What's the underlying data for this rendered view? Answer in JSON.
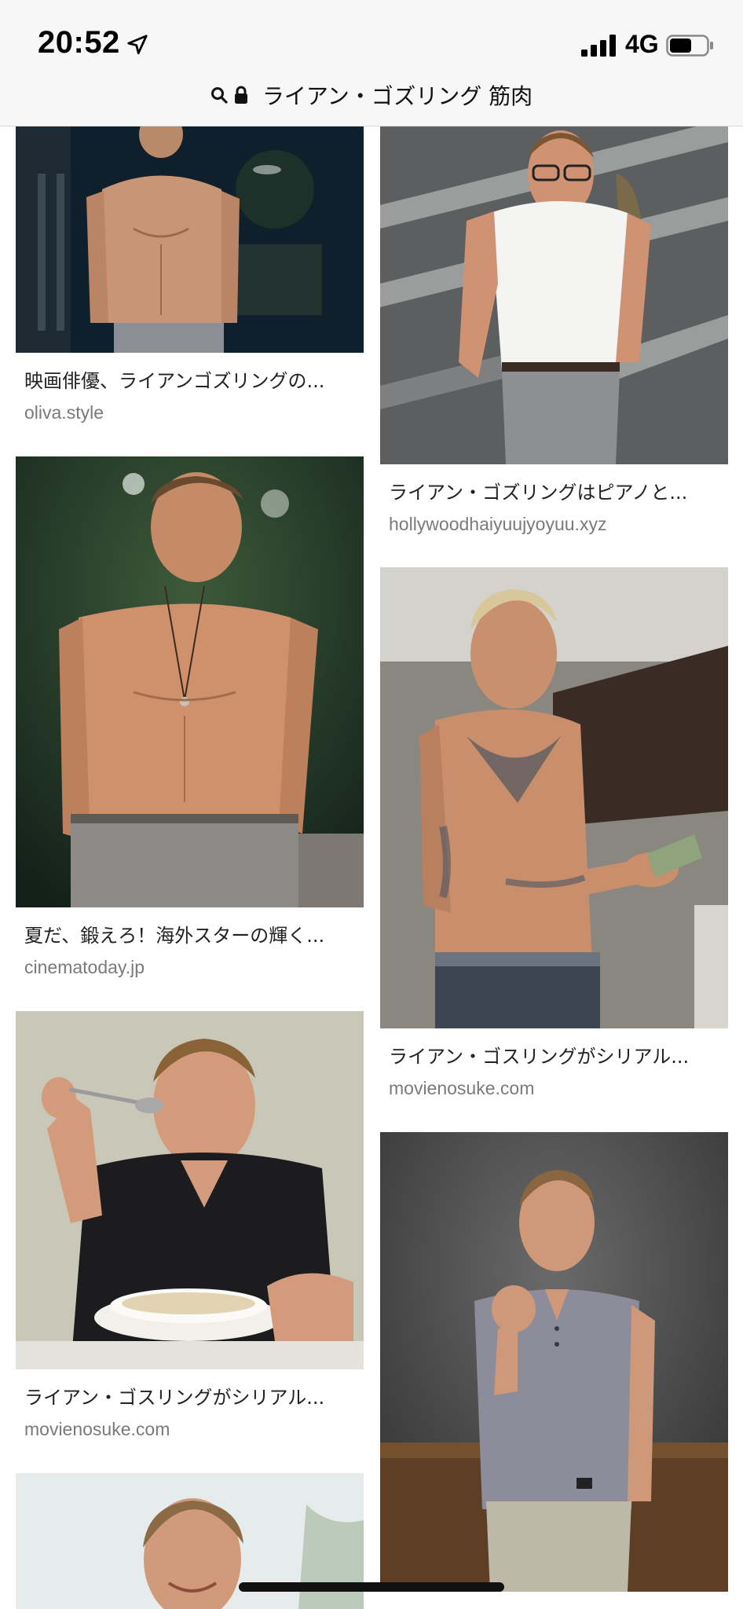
{
  "status_bar": {
    "time": "20:52",
    "network": "4G",
    "battery_level": 0.6
  },
  "address_bar": {
    "query": "ライアン・ゴズリング 筋肉"
  },
  "results": [
    {
      "caption": "映画俳優、ライアンゴズリングの...",
      "source": "oliva.style",
      "scene": "shirtless-night-window"
    },
    {
      "caption": "夏だ、鍛えろ！海外スターの輝く...",
      "source": "cinematoday.jp",
      "scene": "shirtless-necklace"
    },
    {
      "caption": "ライアン・ゴスリングがシリアル...",
      "source": "movienosuke.com",
      "scene": "cereal-spoon"
    },
    {
      "caption": "",
      "source": "",
      "scene": "portrait-smile"
    },
    {
      "caption": "ライアン・ゴズリングはピアノと...",
      "source": "hollywoodhaiyuujyoyuu.xyz",
      "scene": "white-tee-glasses"
    },
    {
      "caption": "ライアン・ゴスリングがシリアル...",
      "source": "movienosuke.com",
      "scene": "tattoos-money"
    },
    {
      "caption": "",
      "source": "",
      "scene": "henley-fist"
    }
  ],
  "colors": {
    "bar_background": "#f7f7f7",
    "caption_text": "#222222",
    "source_text": "#7a7a7a"
  }
}
